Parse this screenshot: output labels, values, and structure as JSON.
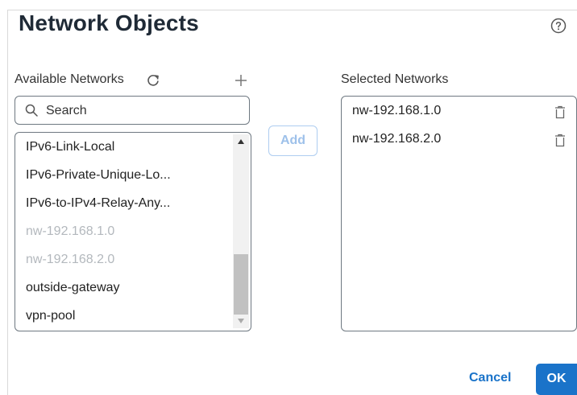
{
  "dialog": {
    "title": "Network Objects",
    "help_icon": "help-circle-icon"
  },
  "available": {
    "label": "Available Networks",
    "refresh_icon": "refresh-icon",
    "add_icon": "plus-icon",
    "search": {
      "placeholder": "Search",
      "value": ""
    },
    "items": [
      {
        "label": "IPv6-Link-Local",
        "disabled": false
      },
      {
        "label": "IPv6-Private-Unique-Lo...",
        "disabled": false
      },
      {
        "label": "IPv6-to-IPv4-Relay-Any...",
        "disabled": false
      },
      {
        "label": "nw-192.168.1.0",
        "disabled": true
      },
      {
        "label": "nw-192.168.2.0",
        "disabled": true
      },
      {
        "label": "outside-gateway",
        "disabled": false
      },
      {
        "label": "vpn-pool",
        "disabled": false
      }
    ]
  },
  "add_button": {
    "label": "Add"
  },
  "selected": {
    "label": "Selected Networks",
    "items": [
      {
        "label": "nw-192.168.1.0",
        "icon": "trash-icon"
      },
      {
        "label": "nw-192.168.2.0",
        "icon": "trash-icon"
      }
    ]
  },
  "footer": {
    "cancel_label": "Cancel",
    "ok_label": "OK"
  },
  "colors": {
    "primary": "#1a73c9",
    "add_disabled": "#9ec1ea",
    "disabled_text": "#b3b8bd",
    "border": "#6e7881"
  }
}
